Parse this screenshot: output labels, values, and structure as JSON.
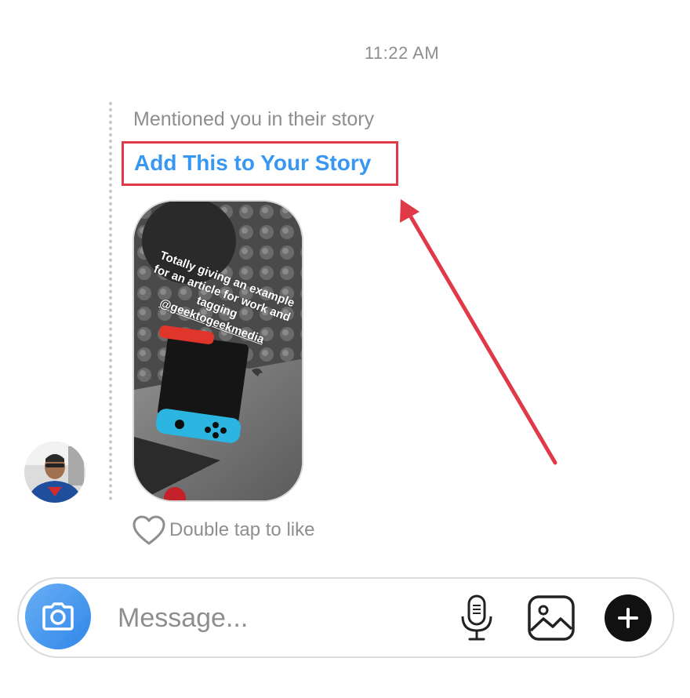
{
  "thread": {
    "timestamp": "11:22 AM",
    "mention_text": "Mentioned you in their story",
    "add_story_label": "Add This to Your Story",
    "story": {
      "caption_lines": [
        "Totally giving an example",
        "for an article for work and",
        "tagging"
      ],
      "mention_handle": "@geektogeekmedia"
    },
    "like_hint": "Double tap to like"
  },
  "composer": {
    "placeholder": "Message...",
    "icons": {
      "camera": "camera-icon",
      "microphone": "microphone-icon",
      "gallery": "gallery-icon",
      "plus": "plus-icon"
    }
  },
  "colors": {
    "link": "#3897f0",
    "annotation": "#e03a48",
    "camera_button": "#3897f0"
  }
}
